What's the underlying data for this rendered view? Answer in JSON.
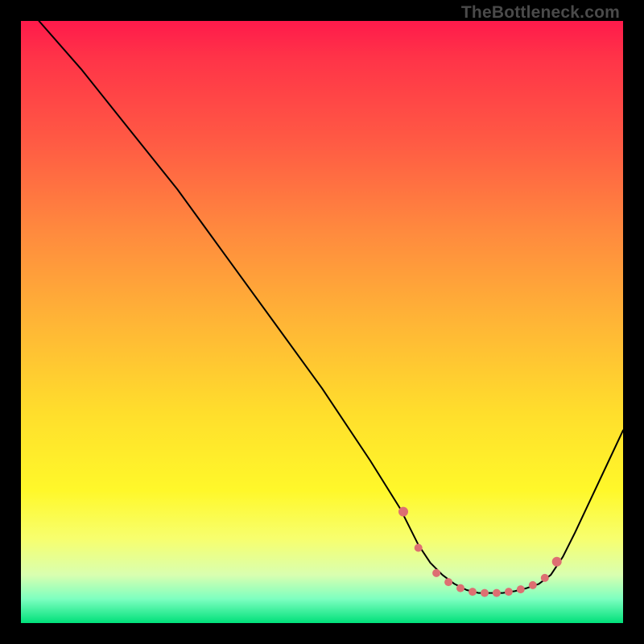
{
  "watermark": "TheBottleneck.com",
  "colors": {
    "page_bg": "#000000",
    "gradient_top": "#ff1a4b",
    "gradient_bottom": "#00e07a",
    "line": "#000000",
    "dots": "#dd6f72"
  },
  "chart_data": {
    "type": "line",
    "title": "",
    "xlabel": "",
    "ylabel": "",
    "xlim": [
      0,
      100
    ],
    "ylim": [
      0,
      100
    ],
    "grid": false,
    "legend": false,
    "note": "values estimated from pixel positions; y=0 at bottom of plot, x=0 at left",
    "series": [
      {
        "name": "curve",
        "x": [
          3,
          10,
          18,
          26,
          34,
          42,
          50,
          58,
          63,
          66,
          68,
          70,
          72,
          74,
          76,
          78,
          80,
          82,
          84,
          86,
          88,
          90,
          92,
          100
        ],
        "y": [
          100,
          92,
          82,
          72,
          61,
          50,
          39,
          27,
          19,
          13,
          10,
          8,
          6.5,
          5.5,
          5,
          5,
          5,
          5.3,
          5.8,
          6.5,
          8,
          11,
          15,
          32
        ]
      }
    ],
    "markers": {
      "name": "highlight-dots",
      "x": [
        63.5,
        66,
        69,
        71,
        73,
        75,
        77,
        79,
        81,
        83,
        85,
        87,
        89
      ],
      "y": [
        18.5,
        12.5,
        8.3,
        6.8,
        5.8,
        5.2,
        5.0,
        5.0,
        5.2,
        5.6,
        6.3,
        7.5,
        10.2
      ]
    }
  }
}
